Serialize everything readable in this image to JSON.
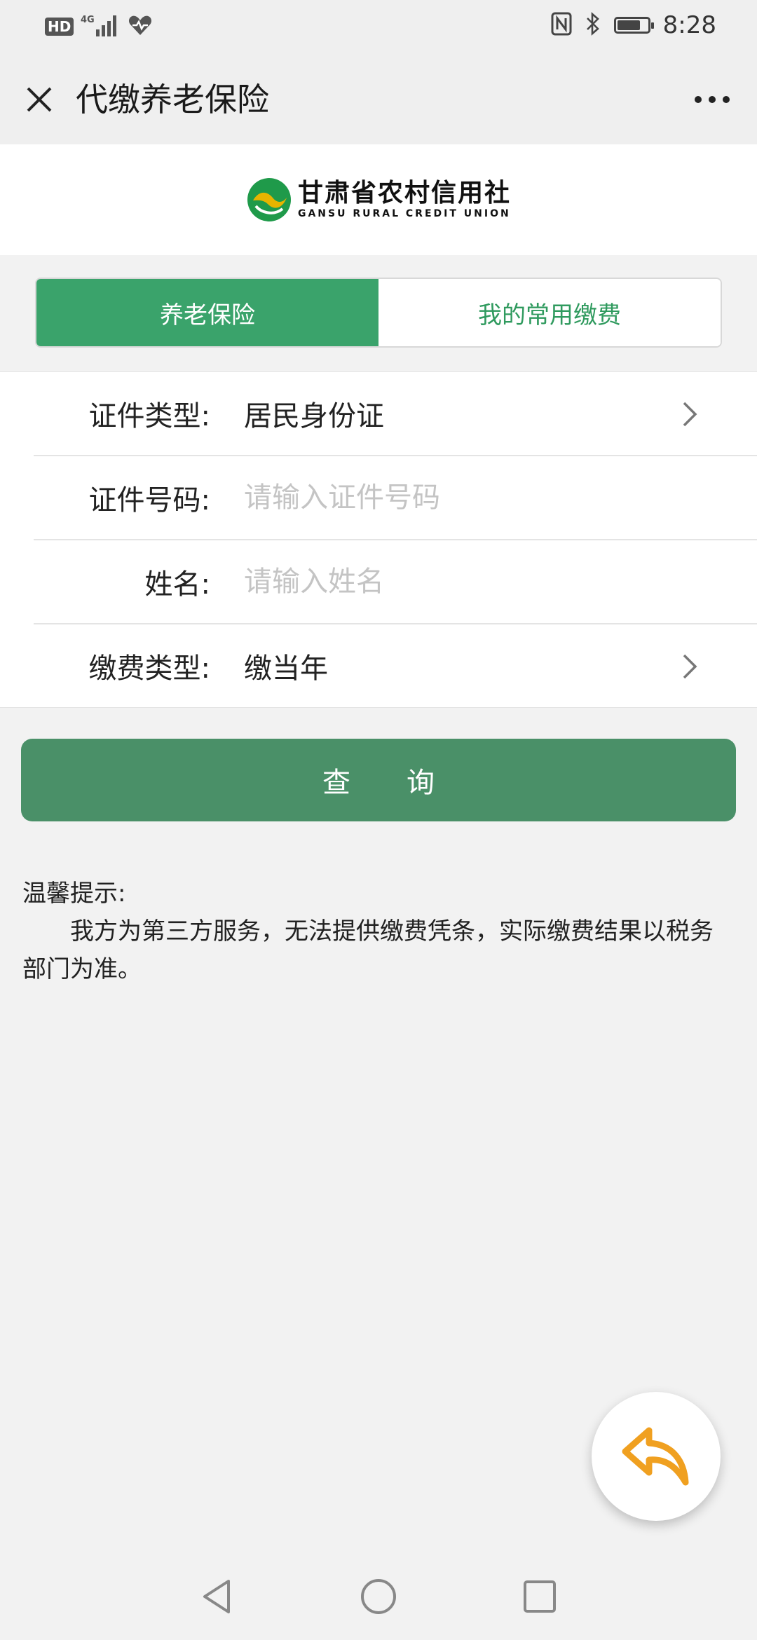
{
  "status_bar": {
    "left_badge": "HD",
    "network": "4G",
    "time": "8:28",
    "battery_level": 0.75,
    "icons": [
      "hd-icon",
      "signal-icon",
      "health-icon",
      "nfc-icon",
      "bluetooth-icon",
      "battery-icon"
    ]
  },
  "header": {
    "title": "代缴养老保险",
    "close_icon": "close-icon",
    "more_icon": "more-icon"
  },
  "logo": {
    "name_cn": "甘肃省农村信用社",
    "name_en": "GANSU RURAL CREDIT UNION",
    "colors": {
      "green": "#1f9a4a",
      "gold": "#e6b400"
    }
  },
  "tabs": [
    {
      "label": "养老保险",
      "active": true
    },
    {
      "label": "我的常用缴费",
      "active": false
    }
  ],
  "form": {
    "id_type": {
      "label": "证件类型:",
      "value": "居民身份证"
    },
    "id_number": {
      "label": "证件号码:",
      "placeholder": "请输入证件号码"
    },
    "name": {
      "label": "姓名:",
      "placeholder": "请输入姓名"
    },
    "payment_type": {
      "label": "缴费类型:",
      "value": "缴当年"
    }
  },
  "query_button": {
    "label": "查　　询"
  },
  "tips": {
    "title": "温馨提示:",
    "body": "我方为第三方服务，无法提供缴费凭条，实际缴费结果以税务部门为准。"
  },
  "colors": {
    "accent": "#3aa36b",
    "button": "#4a9068",
    "back_arrow": "#f0a020"
  }
}
